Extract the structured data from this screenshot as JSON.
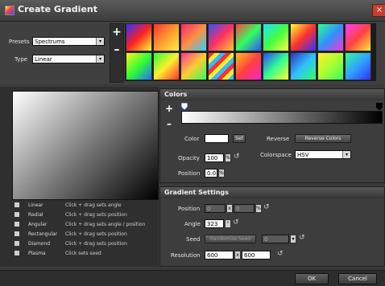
{
  "window": {
    "title": "Create Gradient",
    "close_label": "×"
  },
  "presets": {
    "presets_label": "Presets",
    "presets_value": "Spectrums",
    "type_label": "Type",
    "type_value": "Linear",
    "add_label": "+",
    "remove_label": "–",
    "swatches": [
      "linear-gradient(135deg,#3030ff,#ff2020,#ffff30)",
      "linear-gradient(135deg,#ff3030,#ff9a30,#ffee40)",
      "linear-gradient(135deg,#ff2070,#ff9040,#30d0ff)",
      "linear-gradient(135deg,#3050ff,#ff3060,#ffcc30)",
      "linear-gradient(135deg,#ff4040,#30ff60,#3050ff)",
      "linear-gradient(135deg,#20e0ff,#40ff40,#ffff40)",
      "linear-gradient(135deg,#ffff30,#ff3030,#3030ff)",
      "linear-gradient(135deg,#30ff90,#3090ff,#ff30d0)",
      "linear-gradient(135deg,#ff40ff,#ff4040,#ffee30)",
      "linear-gradient(135deg,#ffee20,#30ff30,#2070ff)",
      "linear-gradient(135deg,#30ff30,#ffee30,#ff3030)",
      "linear-gradient(135deg,#ff30a0,#ffcc30,#30ff60)",
      "repeating-linear-gradient(135deg,#ff3030 0 5px,#ffee30 5px 10px,#30c0ff 10px 15px)",
      "linear-gradient(135deg,#ffbb20,#ff4040,#ff20d0)",
      "linear-gradient(135deg,#3040ff,#30ff90,#ffff30)",
      "linear-gradient(135deg,#3030c0,#30c0ff,#30ff60)",
      "linear-gradient(135deg,#ffee30,#aaff30,#30ff60)",
      "linear-gradient(135deg,#30ff90,#30a0ff,#3030ff)"
    ]
  },
  "types": [
    {
      "name": "Linear",
      "desc": "Click + drag sets angle"
    },
    {
      "name": "Radial",
      "desc": "Click + drag sets position"
    },
    {
      "name": "Angular",
      "desc": "Click + drag sets angle / position"
    },
    {
      "name": "Rectangular",
      "desc": "Click + drag sets position"
    },
    {
      "name": "Diamond",
      "desc": "Click + drag sets position"
    },
    {
      "name": "Plasma",
      "desc": "Click sets seed"
    }
  ],
  "colors": {
    "header": "Colors",
    "add_label": "+",
    "remove_label": "–",
    "color_label": "Color",
    "set_label": "Set",
    "reverse_label": "Reverse",
    "reverse_button": "Reverse Colors",
    "opacity_label": "Opacity",
    "opacity_value": "100",
    "percent": "%",
    "colorspace_label": "Colorspace",
    "colorspace_value": "HSV",
    "position_label": "Position",
    "position_value": "0.0",
    "start_color": "#ffffff",
    "end_color": "#000000"
  },
  "gradient_settings": {
    "header": "Gradient Settings",
    "position_label": "Position",
    "position_x": "0",
    "position_y": "0",
    "x_label": "x",
    "percent": "%",
    "angle_label": "Angle",
    "angle_value": "323",
    "degree": "°",
    "seed_label": "Seed",
    "randomize_label": "Randomize Seed",
    "seed_value": "0",
    "resolution_label": "Resolution",
    "res_w": "600",
    "res_h": "600"
  },
  "footer": {
    "ok": "OK",
    "cancel": "Cancel"
  }
}
